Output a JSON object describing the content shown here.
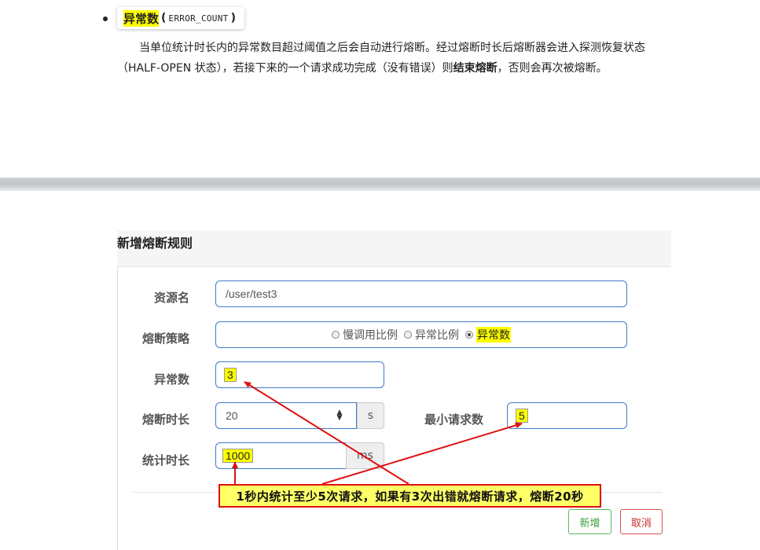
{
  "doc": {
    "term_label": "异常数",
    "term_code": "ERROR_COUNT",
    "paragraph_part1": "当单位统计时长内的异常数目超过阈值之后会自动进行熔断。经过熔断时长后熔断器会进入探测恢复状态（HALF-OPEN 状态），若接下来的一个请求成功完成（没有错误）则",
    "paragraph_bold": "结束熔断",
    "paragraph_part2": "，否则会再次被熔断。"
  },
  "modal": {
    "title": "新增熔断规则",
    "resource": {
      "label": "资源名",
      "value": "/user/test3"
    },
    "strategy": {
      "label": "熔断策略",
      "options": [
        "慢调用比例",
        "异常比例",
        "异常数"
      ],
      "selected": "异常数"
    },
    "error_count": {
      "label": "异常数",
      "value": "3"
    },
    "break_duration": {
      "label": "熔断时长",
      "value": "20",
      "unit": "s"
    },
    "min_requests": {
      "label": "最小请求数",
      "value": "5"
    },
    "stat_duration": {
      "label": "统计时长",
      "value": "1000",
      "unit": "ms"
    },
    "add_button": "新增",
    "cancel_button": "取消"
  },
  "annotation": {
    "callout_text": "1秒内统计至少5次请求，如果有3次出错就熔断请求，熔断20秒",
    "color": "#e01010",
    "highlight": "#ffff00"
  }
}
